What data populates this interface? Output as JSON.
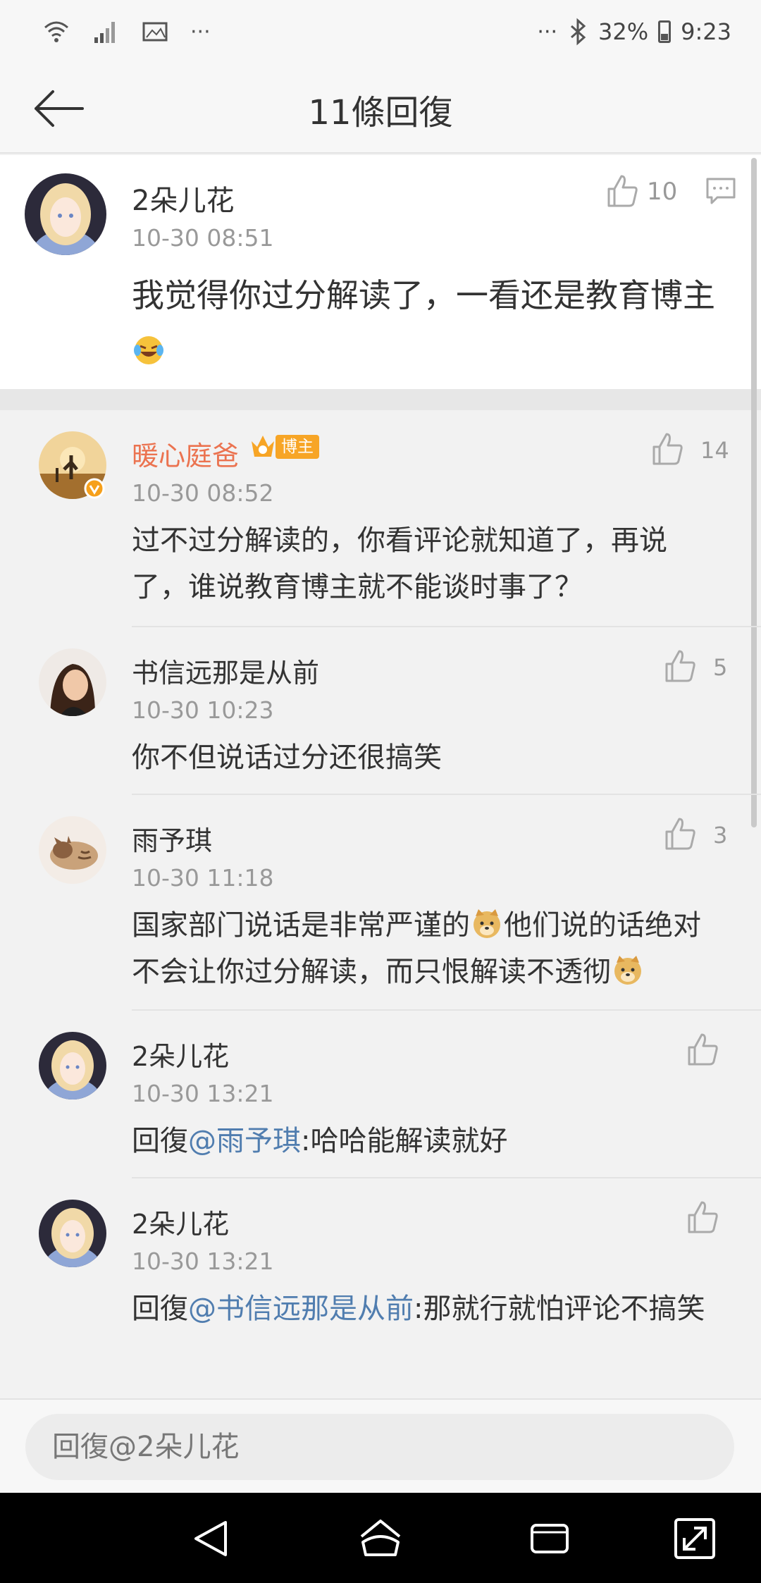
{
  "status_bar": {
    "battery": "32%",
    "time": "9:23",
    "dots": "···"
  },
  "header": {
    "title": "11條回復"
  },
  "root_comment": {
    "author": "2朵儿花",
    "time": "10-30 08:51",
    "text": "我觉得你过分解读了，一看还是教育博主",
    "emoji": "laugh-cry-emoji",
    "like_count": "10"
  },
  "replies": [
    {
      "author": "暖心庭爸",
      "badge": "博主",
      "time": "10-30 08:52",
      "text": "过不过分解读的，你看评论就知道了，再说了，谁说教育博主就不能谈时事了？",
      "like_count": "14"
    },
    {
      "author": "书信远那是从前",
      "time": "10-30 10:23",
      "text": "你不但说话过分还很搞笑",
      "like_count": "5"
    },
    {
      "author": "雨予琪",
      "time": "10-30 11:18",
      "text_part1": "国家部门说话是非常严谨的",
      "text_part2": "他们说的话绝对不会让你过分解读，而只恨解读不透彻",
      "like_count": "3"
    },
    {
      "author": "2朵儿花",
      "time": "10-30 13:21",
      "reply_prefix": "回復",
      "mention": "@雨予琪",
      "text": ":哈哈能解读就好",
      "like_count": ""
    },
    {
      "author": "2朵儿花",
      "time": "10-30 13:21",
      "reply_prefix": "回復",
      "mention": "@书信远那是从前",
      "text": ":那就行就怕评论不搞笑",
      "like_count": ""
    }
  ],
  "input": {
    "placeholder": "回復@2朵儿花"
  },
  "colors": {
    "vip_name": "#eb7350",
    "mention": "#507daf",
    "badge": "#f7a526"
  }
}
